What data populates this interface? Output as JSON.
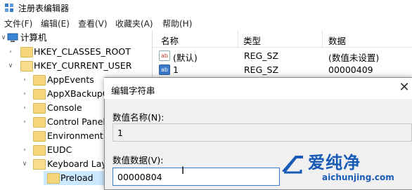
{
  "window": {
    "title": "注册表编辑器"
  },
  "menu": [
    "文件(F)",
    "编辑(E)",
    "查看(V)",
    "收藏夹(A)",
    "帮助(H)"
  ],
  "tree": {
    "root": "计算机",
    "items": [
      {
        "label": "HKEY_CLASSES_ROOT",
        "expanded": false
      },
      {
        "label": "HKEY_CURRENT_USER",
        "expanded": true
      },
      {
        "label": "AppEvents"
      },
      {
        "label": "AppXBackupC"
      },
      {
        "label": "Console"
      },
      {
        "label": "Control Panel"
      },
      {
        "label": "Environment"
      },
      {
        "label": "EUDC"
      },
      {
        "label": "Keyboard Lay"
      },
      {
        "label": "Preload"
      }
    ]
  },
  "list": {
    "headers": {
      "name": "名称",
      "type": "类型",
      "data": "数据"
    },
    "rows": [
      {
        "name": "(默认)",
        "type": "REG_SZ",
        "data": "(数值未设置)",
        "icon": "string-value-icon"
      },
      {
        "name": "1",
        "type": "REG_SZ",
        "data": "00000409",
        "icon": "string-value-icon"
      }
    ]
  },
  "dialog": {
    "title": "编辑字符串",
    "name_label": "数值名称(N):",
    "name_value": "1",
    "data_label": "数值数据(V):",
    "data_value": "00000804"
  },
  "watermark": {
    "brand": "爱纯净",
    "site": "aichunjing.com"
  }
}
